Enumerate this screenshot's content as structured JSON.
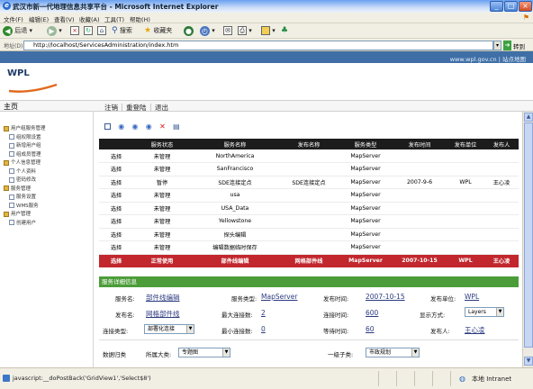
{
  "window": {
    "title": "武汉市新一代地理信息共享平台 - Microsoft Internet Explorer"
  },
  "menu": [
    "文件(F)",
    "编辑(E)",
    "查看(V)",
    "收藏(A)",
    "工具(T)",
    "帮助(H)"
  ],
  "toolbar": {
    "back": "后退",
    "search": "搜索",
    "favorites": "收藏夹"
  },
  "address": {
    "label": "地址(D)",
    "url": "http://localhost/ServicesAdministration/index.htm",
    "go": "转到"
  },
  "site": {
    "links": "www.wpl.gov.cn  |  站点地图",
    "logo": "WPL"
  },
  "nav": {
    "home": "主页",
    "items": [
      "注销",
      "重登陆",
      "退出"
    ]
  },
  "sidebar": [
    {
      "label": "用户组服务管理",
      "type": "folder",
      "level": 0
    },
    {
      "label": "组权限设置",
      "type": "page",
      "level": 1
    },
    {
      "label": "新增用户组",
      "type": "page",
      "level": 1
    },
    {
      "label": "组成员管理",
      "type": "page",
      "level": 1
    },
    {
      "label": "个人信息管理",
      "type": "folder",
      "level": 0
    },
    {
      "label": "个人资料",
      "type": "page",
      "level": 1
    },
    {
      "label": "密码修改",
      "type": "page",
      "level": 1
    },
    {
      "label": "服务管理",
      "type": "folder",
      "level": 0
    },
    {
      "label": "服务设置",
      "type": "page",
      "level": 1
    },
    {
      "label": "WMS服务",
      "type": "page",
      "level": 1
    },
    {
      "label": "用户管理",
      "type": "folder",
      "level": 0
    },
    {
      "label": "创建用户",
      "type": "page",
      "level": 1
    }
  ],
  "grid": {
    "headers": [
      "",
      "服务状态",
      "服务名称",
      "发布名称",
      "服务类型",
      "发布时间",
      "发布单位",
      "发布人"
    ],
    "rows": [
      [
        "选择",
        "未管理",
        "NorthAmerica",
        "",
        "MapServer",
        "",
        "",
        ""
      ],
      [
        "选择",
        "未管理",
        "SanFrancisco",
        "",
        "MapServer",
        "",
        "",
        ""
      ],
      [
        "选择",
        "暂停",
        "SDE连接定点",
        "SDE连接定点",
        "MapServer",
        "2007-9-6",
        "WPL",
        "王心凌"
      ],
      [
        "选择",
        "未管理",
        "usa",
        "",
        "MapServer",
        "",
        "",
        ""
      ],
      [
        "选择",
        "未管理",
        "USA_Data",
        "",
        "MapServer",
        "",
        "",
        ""
      ],
      [
        "选择",
        "未管理",
        "Yellowstone",
        "",
        "MapServer",
        "",
        "",
        ""
      ],
      [
        "选择",
        "未管理",
        "探头编辑",
        "",
        "MapServer",
        "",
        "",
        ""
      ],
      [
        "选择",
        "未管理",
        "编辑数据临时保存",
        "",
        "MapServer",
        "",
        "",
        ""
      ],
      [
        "选择",
        "正常使用",
        "部件线编辑",
        "网格部件线",
        "MapServer",
        "2007-10-15",
        "WPL",
        "王心凌"
      ]
    ],
    "selected_row": 8
  },
  "details": {
    "header": "服务详细信息",
    "service_name_label": "服务名:",
    "service_name": "部件线编辑",
    "service_type_label": "服务类型:",
    "service_type": "MapServer",
    "publish_time_label": "发布时间:",
    "publish_time": "2007-10-15",
    "publish_unit_label": "发布单位:",
    "publish_unit": "WPL",
    "publish_name_label": "发布名:",
    "publish_name": "网格部件线",
    "max_conn_label": "最大连接数:",
    "max_conn": "2",
    "conn_time_label": "连接时间:",
    "conn_time": "600",
    "display_mode_label": "显示方式:",
    "display_mode": "Layers",
    "conn_type_label": "连接类型:",
    "conn_type": "部署化连接",
    "min_conn_label": "最小连接数:",
    "min_conn": "0",
    "wait_time_label": "等待时间:",
    "wait_time": "60",
    "publisher_label": "发布人:",
    "publisher": "王心凌"
  },
  "catalog": {
    "label": "数据归类",
    "class_label": "所属大类:",
    "class_value": "专题图",
    "subclass_label": "一级子类:",
    "subclass_value": "市政规划"
  },
  "status": {
    "text": "javascript:__doPostBack('GridView1','Select$8')",
    "zone": "本地 Intranet"
  },
  "colors": {
    "selected_row": "#c1272d",
    "detail_header": "#4c9d39",
    "grid_header": "#1c1c1c"
  }
}
